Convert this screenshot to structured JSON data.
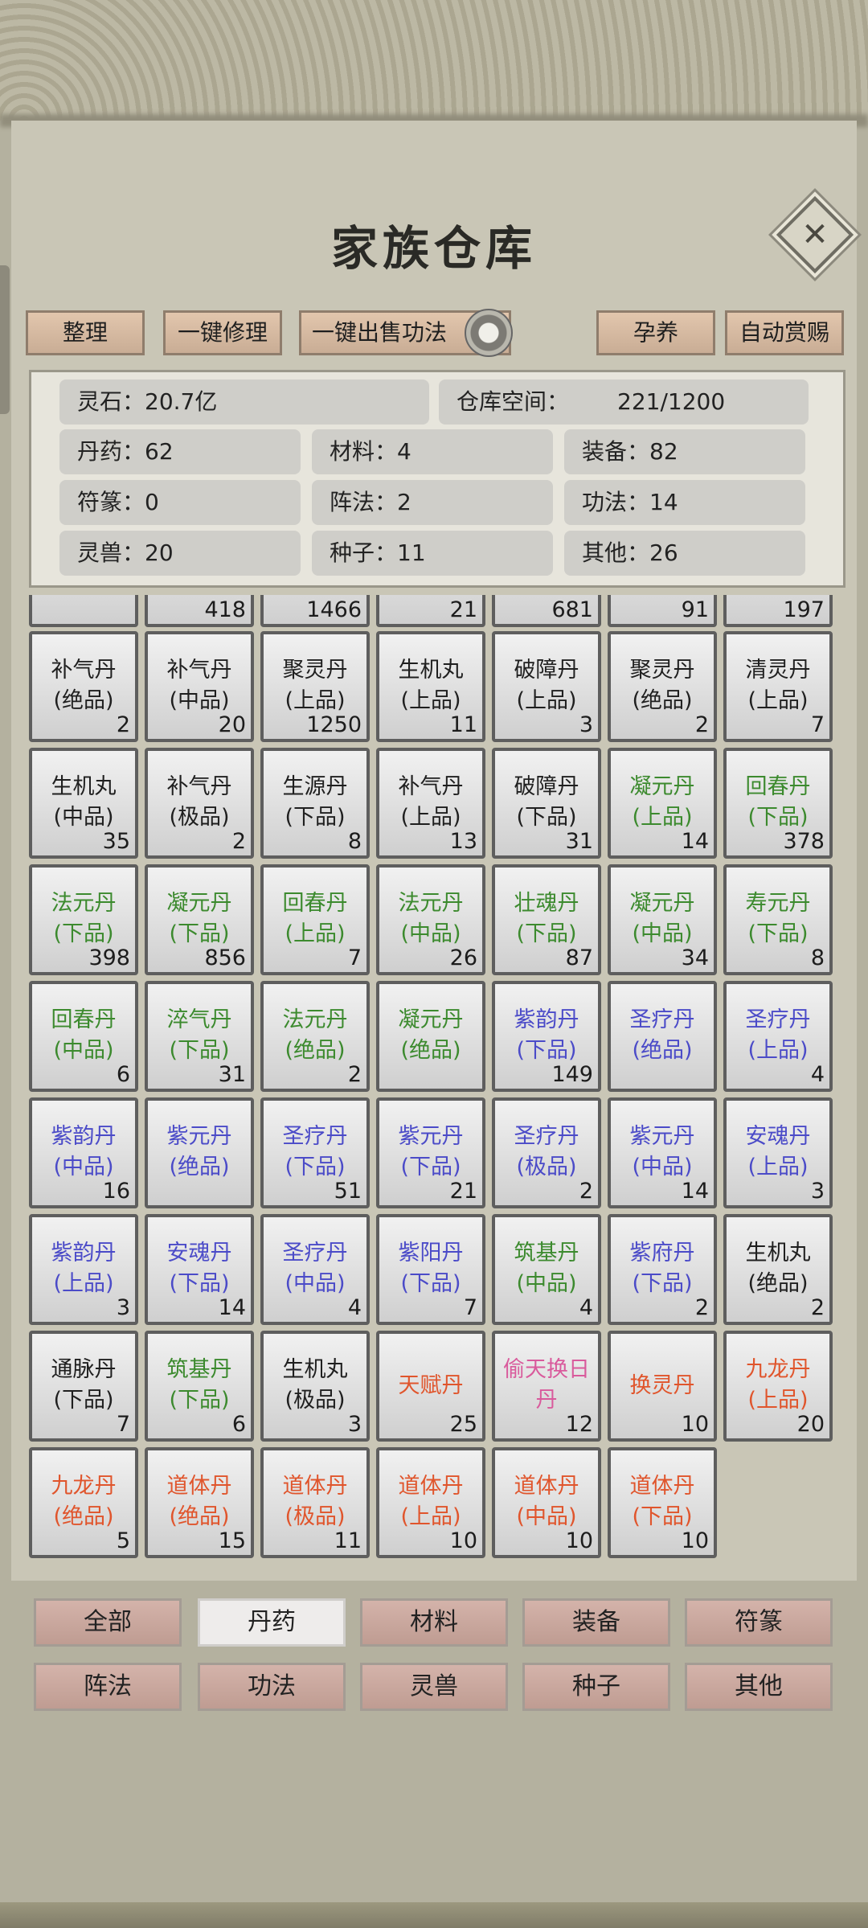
{
  "title": "家族仓库",
  "toolbar": {
    "sort": "整理",
    "repair": "一键修理",
    "sell": "一键出售功法",
    "incubate": "孕养",
    "reward": "自动赏赐"
  },
  "stats": [
    {
      "label": "灵石：",
      "value": "20.7亿"
    },
    {
      "label": "仓库空间：",
      "value": "221/1200"
    },
    {
      "label": "丹药：",
      "value": "62"
    },
    {
      "label": "材料：",
      "value": "4"
    },
    {
      "label": "装备：",
      "value": "82"
    },
    {
      "label": "符篆：",
      "value": "0"
    },
    {
      "label": "阵法：",
      "value": "2"
    },
    {
      "label": "功法：",
      "value": "14"
    },
    {
      "label": "灵兽：",
      "value": "20"
    },
    {
      "label": "种子：",
      "value": "11"
    },
    {
      "label": "其他：",
      "value": "26"
    }
  ],
  "partial_row": [
    "",
    "418",
    "1466",
    "21",
    "681",
    "91",
    "197"
  ],
  "items": [
    {
      "name": "补气丹(绝品)",
      "count": "2",
      "color": "#1f1f1f"
    },
    {
      "name": "补气丹(中品)",
      "count": "20",
      "color": "#1f1f1f"
    },
    {
      "name": "聚灵丹(上品)",
      "count": "1250",
      "color": "#1f1f1f"
    },
    {
      "name": "生机丸(上品)",
      "count": "11",
      "color": "#1f1f1f"
    },
    {
      "name": "破障丹(上品)",
      "count": "3",
      "color": "#1f1f1f"
    },
    {
      "name": "聚灵丹(绝品)",
      "count": "2",
      "color": "#1f1f1f"
    },
    {
      "name": "清灵丹(上品)",
      "count": "7",
      "color": "#1f1f1f"
    },
    {
      "name": "生机丸(中品)",
      "count": "35",
      "color": "#1f1f1f"
    },
    {
      "name": "补气丹(极品)",
      "count": "2",
      "color": "#1f1f1f"
    },
    {
      "name": "生源丹(下品)",
      "count": "8",
      "color": "#1f1f1f"
    },
    {
      "name": "补气丹(上品)",
      "count": "13",
      "color": "#1f1f1f"
    },
    {
      "name": "破障丹(下品)",
      "count": "31",
      "color": "#1f1f1f"
    },
    {
      "name": "凝元丹(上品)",
      "count": "14",
      "color": "#3c8a2e"
    },
    {
      "name": "回春丹(下品)",
      "count": "378",
      "color": "#3c8a2e"
    },
    {
      "name": "法元丹(下品)",
      "count": "398",
      "color": "#3c8a2e"
    },
    {
      "name": "凝元丹(下品)",
      "count": "856",
      "color": "#3c8a2e"
    },
    {
      "name": "回春丹(上品)",
      "count": "7",
      "color": "#3c8a2e"
    },
    {
      "name": "法元丹(中品)",
      "count": "26",
      "color": "#3c8a2e"
    },
    {
      "name": "壮魂丹(下品)",
      "count": "87",
      "color": "#3c8a2e"
    },
    {
      "name": "凝元丹(中品)",
      "count": "34",
      "color": "#3c8a2e"
    },
    {
      "name": "寿元丹(下品)",
      "count": "8",
      "color": "#3c8a2e"
    },
    {
      "name": "回春丹(中品)",
      "count": "6",
      "color": "#3c8a2e"
    },
    {
      "name": "淬气丹(下品)",
      "count": "31",
      "color": "#3c8a2e"
    },
    {
      "name": "法元丹(绝品)",
      "count": "2",
      "color": "#3c8a2e"
    },
    {
      "name": "凝元丹(绝品)",
      "count": "",
      "color": "#3c8a2e"
    },
    {
      "name": "紫韵丹(下品)",
      "count": "149",
      "color": "#4b4bc8"
    },
    {
      "name": "圣疗丹(绝品)",
      "count": "",
      "color": "#4b4bc8"
    },
    {
      "name": "圣疗丹(上品)",
      "count": "4",
      "color": "#4b4bc8"
    },
    {
      "name": "紫韵丹(中品)",
      "count": "16",
      "color": "#4b4bc8"
    },
    {
      "name": "紫元丹(绝品)",
      "count": "",
      "color": "#4b4bc8"
    },
    {
      "name": "圣疗丹(下品)",
      "count": "51",
      "color": "#4b4bc8"
    },
    {
      "name": "紫元丹(下品)",
      "count": "21",
      "color": "#4b4bc8"
    },
    {
      "name": "圣疗丹(极品)",
      "count": "2",
      "color": "#4b4bc8"
    },
    {
      "name": "紫元丹(中品)",
      "count": "14",
      "color": "#4b4bc8"
    },
    {
      "name": "安魂丹(上品)",
      "count": "3",
      "color": "#4b4bc8"
    },
    {
      "name": "紫韵丹(上品)",
      "count": "3",
      "color": "#4b4bc8"
    },
    {
      "name": "安魂丹(下品)",
      "count": "14",
      "color": "#4b4bc8"
    },
    {
      "name": "圣疗丹(中品)",
      "count": "4",
      "color": "#4b4bc8"
    },
    {
      "name": "紫阳丹(下品)",
      "count": "7",
      "color": "#4b4bc8"
    },
    {
      "name": "筑基丹(中品)",
      "count": "4",
      "color": "#3c8a2e"
    },
    {
      "name": "紫府丹(下品)",
      "count": "2",
      "color": "#4b4bc8"
    },
    {
      "name": "生机丸(绝品)",
      "count": "2",
      "color": "#1f1f1f"
    },
    {
      "name": "通脉丹(下品)",
      "count": "7",
      "color": "#1f1f1f"
    },
    {
      "name": "筑基丹(下品)",
      "count": "6",
      "color": "#3c8a2e"
    },
    {
      "name": "生机丸(极品)",
      "count": "3",
      "color": "#1f1f1f"
    },
    {
      "name": "天赋丹",
      "count": "25",
      "color": "#e0552c"
    },
    {
      "name": "偷天换日丹",
      "count": "12",
      "color": "#d95a9c"
    },
    {
      "name": "换灵丹",
      "count": "10",
      "color": "#e0552c"
    },
    {
      "name": "九龙丹(上品)",
      "count": "20",
      "color": "#e0552c"
    },
    {
      "name": "九龙丹(绝品)",
      "count": "5",
      "color": "#e0552c"
    },
    {
      "name": "道体丹(绝品)",
      "count": "15",
      "color": "#e0552c"
    },
    {
      "name": "道体丹(极品)",
      "count": "11",
      "color": "#e0552c"
    },
    {
      "name": "道体丹(上品)",
      "count": "10",
      "color": "#e0552c"
    },
    {
      "name": "道体丹(中品)",
      "count": "10",
      "color": "#e0552c"
    },
    {
      "name": "道体丹(下品)",
      "count": "10",
      "color": "#e0552c"
    }
  ],
  "tabs": [
    "全部",
    "丹药",
    "材料",
    "装备",
    "符篆",
    "阵法",
    "功法",
    "灵兽",
    "种子",
    "其他"
  ],
  "active_tab": "丹药"
}
